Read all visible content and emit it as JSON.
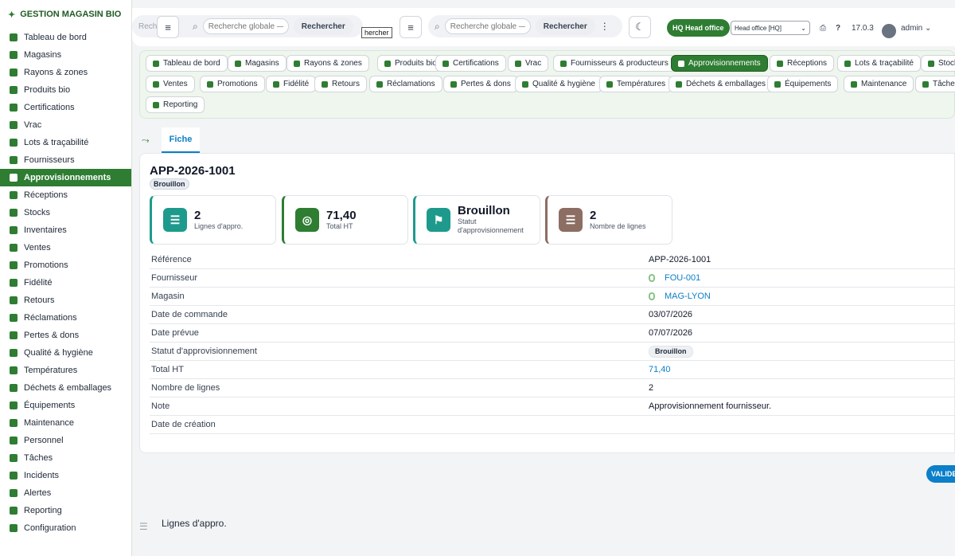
{
  "app": {
    "brand": "GESTION MAGASIN BIO"
  },
  "sidebar": {
    "items": [
      {
        "label": "Tableau de bord"
      },
      {
        "label": "Magasins"
      },
      {
        "label": "Rayons & zones"
      },
      {
        "label": "Produits bio"
      },
      {
        "label": "Certifications"
      },
      {
        "label": "Vrac"
      },
      {
        "label": "Lots & traçabilité"
      },
      {
        "label": "Fournisseurs"
      },
      {
        "label": "Approvisionnements",
        "active": true
      },
      {
        "label": "Réceptions"
      },
      {
        "label": "Stocks"
      },
      {
        "label": "Inventaires"
      },
      {
        "label": "Ventes"
      },
      {
        "label": "Promotions"
      },
      {
        "label": "Fidélité"
      },
      {
        "label": "Retours"
      },
      {
        "label": "Réclamations"
      },
      {
        "label": "Pertes & dons"
      },
      {
        "label": "Qualité & hygiène"
      },
      {
        "label": "Températures"
      },
      {
        "label": "Déchets & emballages"
      },
      {
        "label": "Équipements"
      },
      {
        "label": "Maintenance"
      },
      {
        "label": "Personnel"
      },
      {
        "label": "Tâches"
      },
      {
        "label": "Incidents"
      },
      {
        "label": "Alertes"
      },
      {
        "label": "Reporting"
      },
      {
        "label": "Configuration"
      }
    ]
  },
  "topbar": {
    "search_placeholder_1": "Recherche globale — ct",
    "search_button_1": "Rechercher",
    "partial_left": "Reche",
    "search_placeholder_2": "Recherche globale — ct",
    "search_button_2": "Rechercher",
    "tooltip": "hercher",
    "hq_badge": "HQ Head office",
    "store_select": "Head office [HQ]",
    "version": "17.0.3",
    "user": "admin"
  },
  "modules": [
    {
      "label": "Tableau de bord"
    },
    {
      "label": "Magasins"
    },
    {
      "label": "Rayons & zones"
    },
    {
      "label": "Produits bio"
    },
    {
      "label": "Certifications"
    },
    {
      "label": "Vrac"
    },
    {
      "label": "Fournisseurs & producteurs"
    },
    {
      "label": "Approvisionnements",
      "active": true
    },
    {
      "label": "Réceptions"
    },
    {
      "label": "Lots & traçabilité"
    },
    {
      "label": "Stock"
    },
    {
      "label": "Ventes"
    },
    {
      "label": "Promotions"
    },
    {
      "label": "Fidélité"
    },
    {
      "label": "Retours"
    },
    {
      "label": "Réclamations"
    },
    {
      "label": "Pertes & dons"
    },
    {
      "label": "Qualité & hygiène"
    },
    {
      "label": "Températures"
    },
    {
      "label": "Déchets & emballages"
    },
    {
      "label": "Équipements"
    },
    {
      "label": "Maintenance"
    },
    {
      "label": "Tâches"
    },
    {
      "label": "Reporting"
    }
  ],
  "tab": {
    "label": "Fiche"
  },
  "record": {
    "title": "APP-2026-1001",
    "status_badge": "Brouillon",
    "stats": [
      {
        "value": "2",
        "label": "Lignes d'appro.",
        "color": "#1e9a8c"
      },
      {
        "value": "71,40",
        "label": "Total HT",
        "color": "#2e7d32"
      },
      {
        "value": "Brouillon",
        "label": "Statut d'approvisionnement",
        "color": "#1e9a8c"
      },
      {
        "value": "2",
        "label": "Nombre de lignes",
        "color": "#8d6e63"
      }
    ],
    "fields": [
      {
        "key": "Référence",
        "value": "APP-2026-1001"
      },
      {
        "key": "Fournisseur",
        "value": "FOU-001",
        "link": true
      },
      {
        "key": "Magasin",
        "value": "MAG-LYON",
        "link": true
      },
      {
        "key": "Date de commande",
        "value": "03/07/2026"
      },
      {
        "key": "Date prévue",
        "value": "07/07/2026"
      },
      {
        "key": "Statut d'approvisionnement",
        "value": "Brouillon",
        "badge": true
      },
      {
        "key": "Total HT",
        "value": "71,40",
        "link": true
      },
      {
        "key": "Nombre de lignes",
        "value": "2"
      },
      {
        "key": "Note",
        "value": "Approvisionnement fournisseur."
      },
      {
        "key": "Date de création",
        "value": ""
      }
    ]
  },
  "actions": {
    "validate": "VALIDE"
  },
  "lines_section": {
    "title": "Lignes d'appro."
  }
}
